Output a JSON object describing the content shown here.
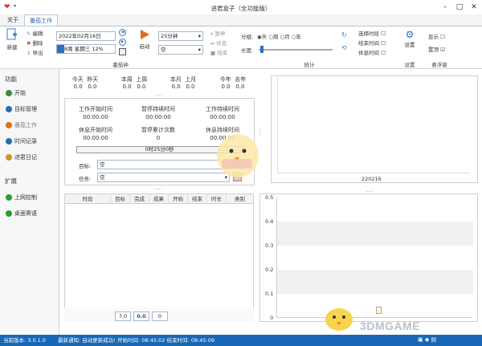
{
  "window": {
    "title": "进君盒子（全功能版）"
  },
  "tabs": [
    {
      "label": "关于"
    },
    {
      "label": "番茄工作"
    }
  ],
  "ribbon": {
    "new_label": "新建",
    "edit_label": "编辑",
    "delete_label": "删除",
    "export_label": "导出",
    "date_value": "2022年02月16日",
    "week_value": "8周 星期三 12%",
    "tomato_label": "番茄钟",
    "start_label": "启动",
    "duration_value": "25分钟",
    "task_value": "空",
    "pause_label": "暂停",
    "rest_label": "休息",
    "end_label": "结束",
    "group_label": "分组:",
    "group_options": [
      "天",
      "周",
      "月",
      "年"
    ],
    "length_label": "长度:",
    "stats_label": "统计",
    "select_time_label": "选择时段",
    "end_time_label": "结束时间",
    "rest_time_label": "休息时间",
    "settings_label": "设置",
    "settings_group_label": "设置",
    "show_label": "显示",
    "pin_label": "置顶",
    "float_label": "悬浮窗"
  },
  "sidebar": {
    "functions_header": "功能",
    "items": [
      {
        "label": "开始",
        "color": "#3b8d3b"
      },
      {
        "label": "目标管理",
        "color": "#2a6db0"
      },
      {
        "label": "番茄工作",
        "color": "#d9731b"
      },
      {
        "label": "时间记录",
        "color": "#2a6db0"
      },
      {
        "label": "进君日记",
        "color": "#c9971a"
      }
    ],
    "extend_header": "扩展",
    "ext_items": [
      {
        "label": "上网控制",
        "color": "#2d9d2d"
      },
      {
        "label": "桌面寄语",
        "color": "#2d9d2d"
      }
    ]
  },
  "stats": {
    "day": {
      "labels": [
        "今天",
        "昨天"
      ],
      "values": [
        "0.0",
        "0.0"
      ]
    },
    "week": {
      "labels": [
        "本周",
        "上周"
      ],
      "values": [
        "0.0",
        "0.0"
      ]
    },
    "month": {
      "labels": [
        "本月",
        "上月"
      ],
      "values": [
        "0.0",
        "0.0"
      ]
    },
    "year": {
      "labels": [
        "今年",
        "去年"
      ],
      "values": [
        "0.0",
        "0.0"
      ]
    }
  },
  "work": {
    "start_label": "工作开始时间",
    "start_value": "00:00:00",
    "pause_total_label": "暂停持续时间",
    "pause_total_value": "00:00:00",
    "work_total_label": "工作持续时间",
    "work_total_value": "00:00:00",
    "rest_start_label": "休息开始时间",
    "rest_start_value": "00:00:00",
    "pause_count_label": "暂停累计次数",
    "pause_count_value": "0",
    "rest_total_label": "休息持续时间",
    "rest_total_value": "00:00:00",
    "timer_value": "0时25分0秒",
    "goal_label": "目标:",
    "goal_value": "空",
    "task_label": "任务:",
    "task_value": "空"
  },
  "table": {
    "headers": [
      "时段",
      "目标",
      "完成",
      "成果",
      "开始",
      "结束",
      "时长",
      "类别"
    ],
    "totals": [
      "7.0",
      "0.0",
      "0"
    ]
  },
  "chart_data": [
    {
      "type": "bar",
      "categories": [
        "220216"
      ],
      "values": [],
      "xlabel": "",
      "ylabel": ""
    },
    {
      "type": "bar",
      "categories": [],
      "values": [],
      "ylim": [
        0,
        0.5
      ],
      "yticks": [
        "0.5",
        "0.4",
        "0.3",
        "0.2",
        "0.1",
        "0"
      ]
    }
  ],
  "status": {
    "version_label": "当前版本:",
    "version_value": "3.0.1.0",
    "notice_label": "最新通知:",
    "notice_value": "自动更新成功!",
    "start_label": "开始时间:",
    "start_value": "08:45:02",
    "end_label": "结束时间:",
    "end_value": "08:45:09"
  },
  "watermark": "3DMGAME"
}
